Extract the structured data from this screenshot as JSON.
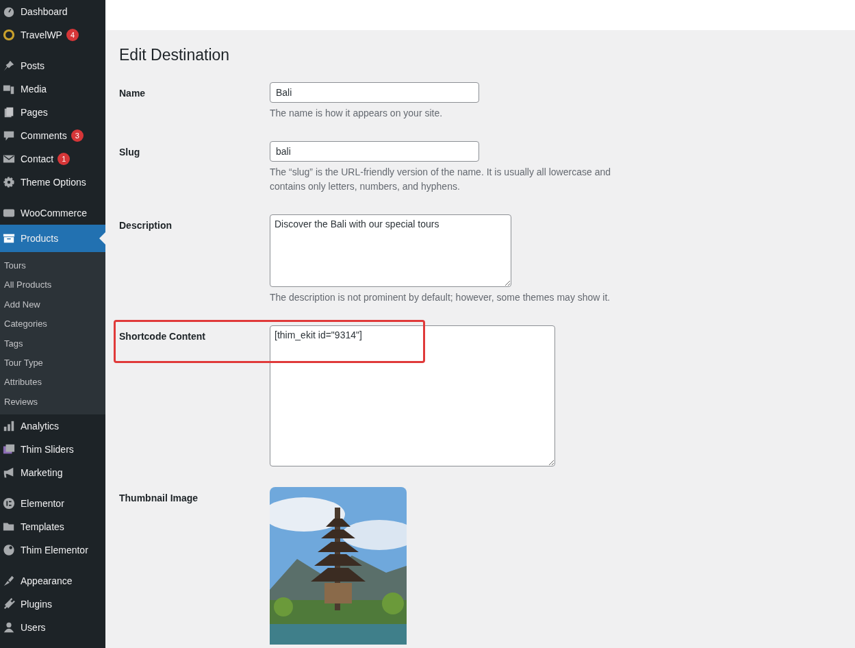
{
  "sidebar": {
    "groups": [
      [
        {
          "label": "Dashboard",
          "selected": false
        },
        {
          "label": "TravelWP",
          "badge": "4",
          "selected": false
        }
      ],
      [
        {
          "label": "Posts",
          "selected": false
        },
        {
          "label": "Media",
          "selected": false
        },
        {
          "label": "Pages",
          "selected": false
        },
        {
          "label": "Comments",
          "badge": "3",
          "selected": false
        },
        {
          "label": "Contact",
          "badge": "1",
          "selected": false
        },
        {
          "label": "Theme Options",
          "selected": false
        }
      ],
      [
        {
          "label": "WooCommerce",
          "selected": false
        },
        {
          "label": "Products",
          "selected": true,
          "children": [
            {
              "label": "Tours",
              "selected": false
            },
            {
              "label": "All Products",
              "selected": false
            },
            {
              "label": "Add New",
              "selected": false
            },
            {
              "label": "Categories",
              "selected": false
            },
            {
              "label": "Tags",
              "selected": false
            },
            {
              "label": "Tour Type",
              "selected": false
            },
            {
              "label": "Attributes",
              "selected": false
            },
            {
              "label": "Reviews",
              "selected": false
            }
          ]
        },
        {
          "label": "Analytics",
          "selected": false
        },
        {
          "label": "Thim Sliders",
          "selected": false
        },
        {
          "label": "Marketing",
          "selected": false
        }
      ],
      [
        {
          "label": "Elementor",
          "selected": false
        },
        {
          "label": "Templates",
          "selected": false
        },
        {
          "label": "Thim Elementor",
          "selected": false
        }
      ],
      [
        {
          "label": "Appearance",
          "selected": false
        },
        {
          "label": "Plugins",
          "selected": false
        },
        {
          "label": "Users",
          "selected": false
        }
      ]
    ]
  },
  "page": {
    "title": "Edit Destination"
  },
  "form": {
    "fields": [
      {
        "kind": "input",
        "label": "Name",
        "value": "Bali",
        "hint": "The name is how it appears on your site."
      },
      {
        "kind": "input",
        "label": "Slug",
        "value": "bali",
        "hint": "The “slug” is the URL-friendly version of the name. It is usually all lowercase and contains only letters, numbers, and hyphens."
      },
      {
        "kind": "textarea",
        "label": "Description",
        "value": "Discover the Bali with our special tours",
        "hint": "The description is not prominent by default; however, some themes may show it."
      },
      {
        "kind": "textarea_large",
        "label": "Shortcode Content",
        "value": "[thim_ekit id=\"9314\"]",
        "highlighted": true
      },
      {
        "label": "Thumbnail Image"
      }
    ]
  }
}
